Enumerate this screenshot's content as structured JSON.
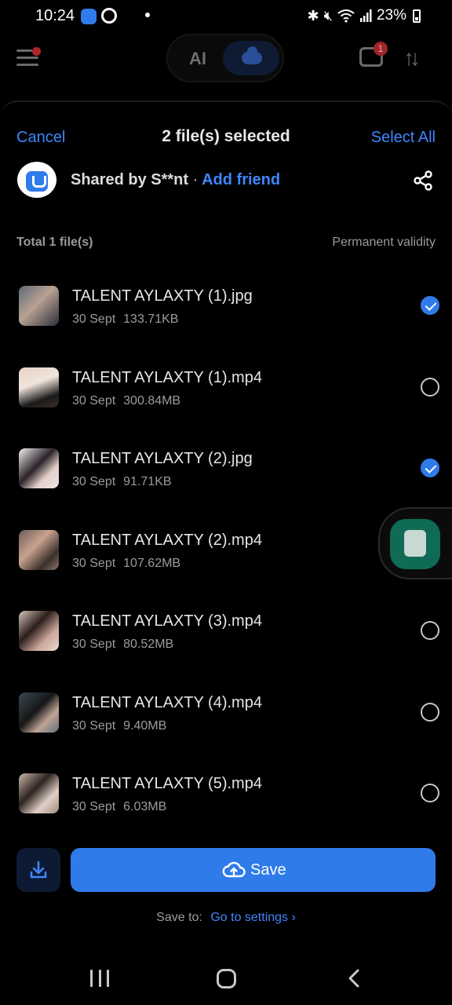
{
  "status_bar": {
    "time": "10:24",
    "battery": "23%",
    "icons": [
      "app-notification-icon",
      "ring-icon",
      "bluetooth-icon",
      "mute-icon",
      "wifi-icon",
      "signal-icon",
      "battery-icon"
    ]
  },
  "app_bar": {
    "mode_ai_label": "AI",
    "chat_badge_count": "1"
  },
  "sheet": {
    "cancel_label": "Cancel",
    "title": "2 file(s) selected",
    "select_all_label": "Select All",
    "shared_by": "Shared by S**nt",
    "separator": "·",
    "add_friend_label": "Add friend",
    "total_label": "Total 1 file(s)",
    "validity_label": "Permanent validity"
  },
  "files": [
    {
      "name": "TALENT AYLAXTY (1).jpg",
      "date": "30 Sept",
      "size": "133.71KB",
      "selected": true
    },
    {
      "name": "TALENT AYLAXTY (1).mp4",
      "date": "30 Sept",
      "size": "300.84MB",
      "selected": false
    },
    {
      "name": "TALENT AYLAXTY (2).jpg",
      "date": "30 Sept",
      "size": "91.71KB",
      "selected": true
    },
    {
      "name": "TALENT AYLAXTY (2).mp4",
      "date": "30 Sept",
      "size": "107.62MB",
      "selected": false
    },
    {
      "name": "TALENT AYLAXTY (3).mp4",
      "date": "30 Sept",
      "size": "80.52MB",
      "selected": false
    },
    {
      "name": "TALENT AYLAXTY (4).mp4",
      "date": "30 Sept",
      "size": "9.40MB",
      "selected": false
    },
    {
      "name": "TALENT AYLAXTY (5).mp4",
      "date": "30 Sept",
      "size": "6.03MB",
      "selected": false
    }
  ],
  "actions": {
    "save_label": "Save",
    "save_to_label": "Save to:",
    "go_to_settings_label": "Go to settings",
    "chevron": "›"
  },
  "colors": {
    "accent": "#2f7bea",
    "link": "#3f86ff",
    "background": "#000000"
  }
}
